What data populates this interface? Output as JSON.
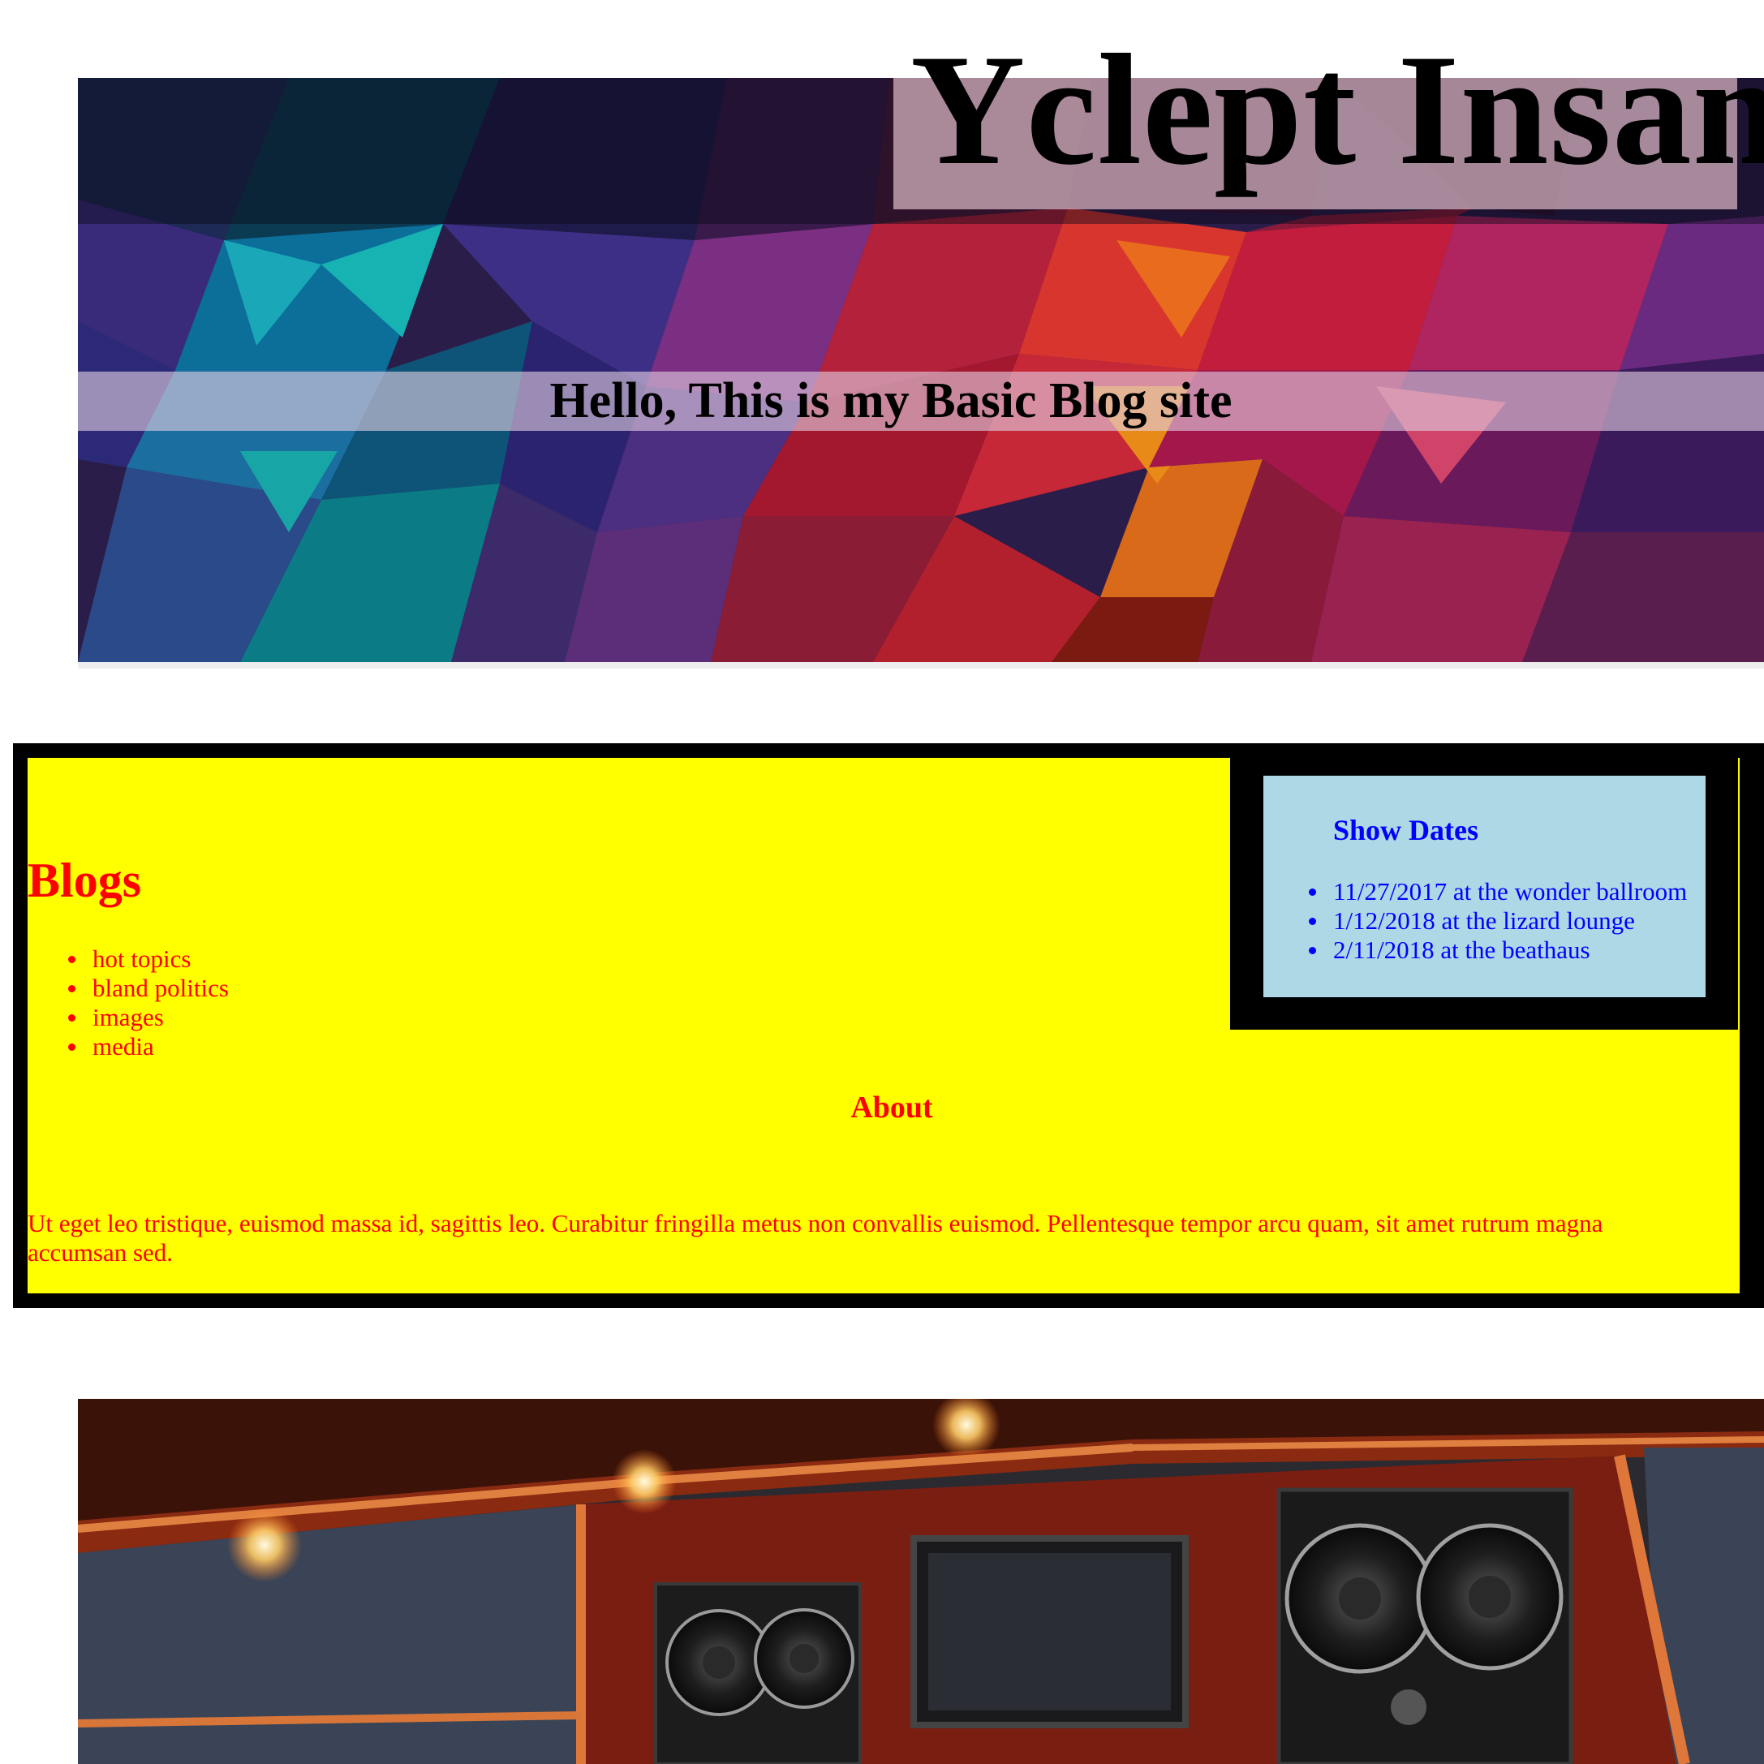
{
  "header": {
    "site_title": "Yclept Insan",
    "subtitle": "Hello, This is my Basic Blog site"
  },
  "blogs": {
    "heading": "Blogs",
    "items": [
      {
        "label": "hot topics"
      },
      {
        "label": "bland politics"
      },
      {
        "label": "images"
      },
      {
        "label": "media"
      }
    ]
  },
  "about": {
    "heading": "About",
    "text": "Ut eget leo tristique, euismod massa id, sagittis leo. Curabitur fringilla metus non convallis euismod. Pellentesque tempor arcu quam, sit amet rutrum magna accumsan sed."
  },
  "show_dates": {
    "heading": "Show Dates",
    "items": [
      {
        "label": "11/27/2017 at the wonder ballroom"
      },
      {
        "label": "1/12/2018 at the lizard lounge"
      },
      {
        "label": "2/11/2018 at the beathaus"
      }
    ]
  },
  "colors": {
    "content_background": "#ffff00",
    "content_text": "#ff0000",
    "aside_background": "#add8e6",
    "aside_text": "#0000ff",
    "frame": "#000000"
  }
}
